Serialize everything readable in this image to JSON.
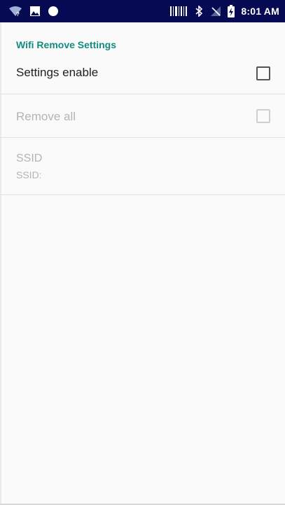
{
  "status_bar": {
    "time": "8:01 AM",
    "left_icons": [
      "wifi-question-icon",
      "image-icon",
      "circle-icon"
    ],
    "right_icons": [
      "barcode-scanner-icon",
      "bluetooth-icon",
      "signal-off-icon",
      "battery-charging-icon"
    ]
  },
  "header": {
    "category_title": "Wifi Remove Settings"
  },
  "preferences": {
    "settings_enable": {
      "label": "Settings enable",
      "checked": false,
      "enabled": true
    },
    "remove_all": {
      "label": "Remove all",
      "checked": false,
      "enabled": false
    },
    "ssid": {
      "label": "SSID",
      "summary": "SSID:",
      "enabled": false
    }
  },
  "colors": {
    "status_bar_bg": "#050a52",
    "accent": "#138c7e",
    "disabled_text": "#b4b4b4",
    "background": "#fafafa"
  }
}
